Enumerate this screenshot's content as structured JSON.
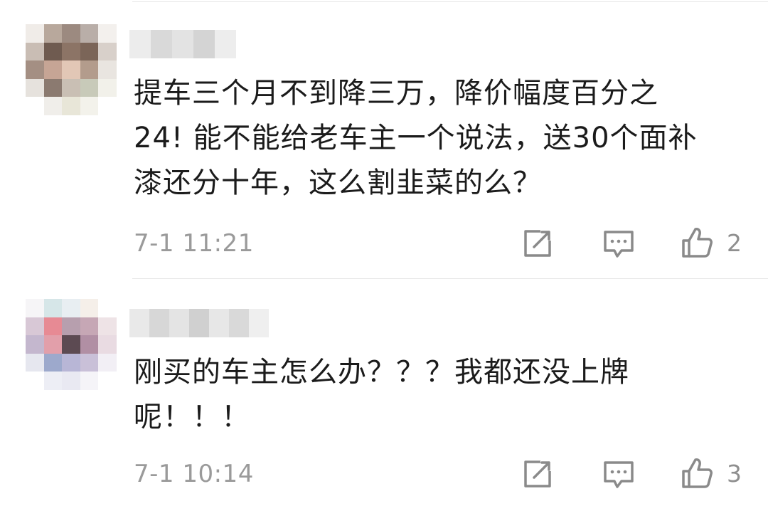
{
  "comments": [
    {
      "text": "提车三个月不到降三万，降价幅度百分之\n24! 能不能给老车主一个说法，送30个面补\n漆还分十年，这么割韭菜的么？",
      "time": "7-1 11:21",
      "likes": "2",
      "icons": [
        "share-icon",
        "reply-icon",
        "like-icon"
      ]
    },
    {
      "text": "刚买的车主怎么办？？？我都还没上牌\n呢！！！",
      "time": "7-1 10:14",
      "likes": "3",
      "icons": [
        "share-icon",
        "reply-icon",
        "like-icon"
      ]
    }
  ],
  "colors": {
    "text": "#1b1b1b",
    "meta": "#9a9a9a",
    "icon": "#8a8a8a",
    "divider": "#e6e6e6"
  }
}
